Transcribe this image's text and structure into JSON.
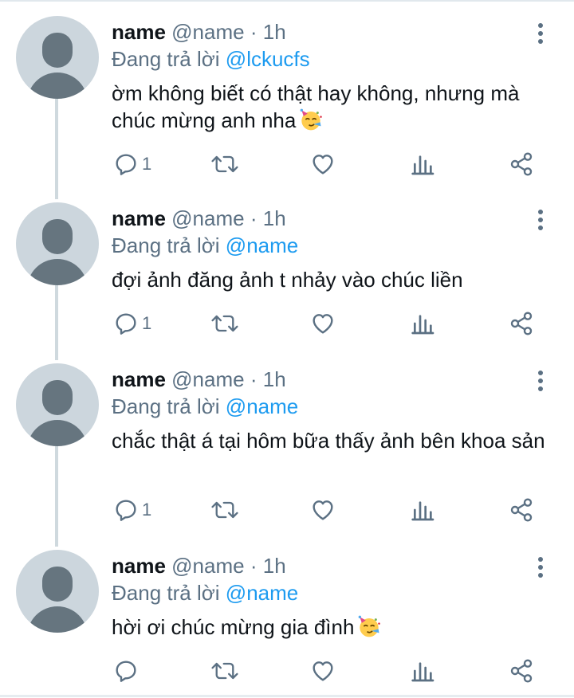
{
  "colors": {
    "link": "#1d9bf0",
    "muted": "#5b7083",
    "text": "#0f1419",
    "avatar_bg": "#ccd6dd",
    "avatar_fg": "#66757f",
    "thread_line": "#cfd9de"
  },
  "icons": [
    "more-vertical-icon",
    "reply-icon",
    "retweet-icon",
    "like-icon",
    "views-icon",
    "share-icon",
    "party-face-emoji"
  ],
  "tweets": [
    {
      "name": "name",
      "handle": "@name",
      "separator": "·",
      "time": "1h",
      "replying_label": "Đang trả lời",
      "replying_to": "@lckucfs",
      "text": "ờm không biết có thật hay không, nhưng mà chúc mừng anh nha",
      "has_emoji": true,
      "reply_count": "1"
    },
    {
      "name": "name",
      "handle": "@name",
      "separator": "·",
      "time": "1h",
      "replying_label": "Đang trả lời",
      "replying_to": "@name",
      "text": "đợi ảnh đăng ảnh t nhảy vào chúc liền",
      "has_emoji": false,
      "reply_count": "1"
    },
    {
      "name": "name",
      "handle": "@name",
      "separator": "·",
      "time": "1h",
      "replying_label": "Đang trả lời",
      "replying_to": "@name",
      "text": "chắc thật á tại hôm bữa thấy ảnh bên khoa sản",
      "has_emoji": false,
      "reply_count": "1"
    },
    {
      "name": "name",
      "handle": "@name",
      "separator": "·",
      "time": "1h",
      "replying_label": "Đang trả lời",
      "replying_to": "@name",
      "text": "hời ơi chúc mừng gia đình",
      "has_emoji": true,
      "reply_count": ""
    }
  ]
}
